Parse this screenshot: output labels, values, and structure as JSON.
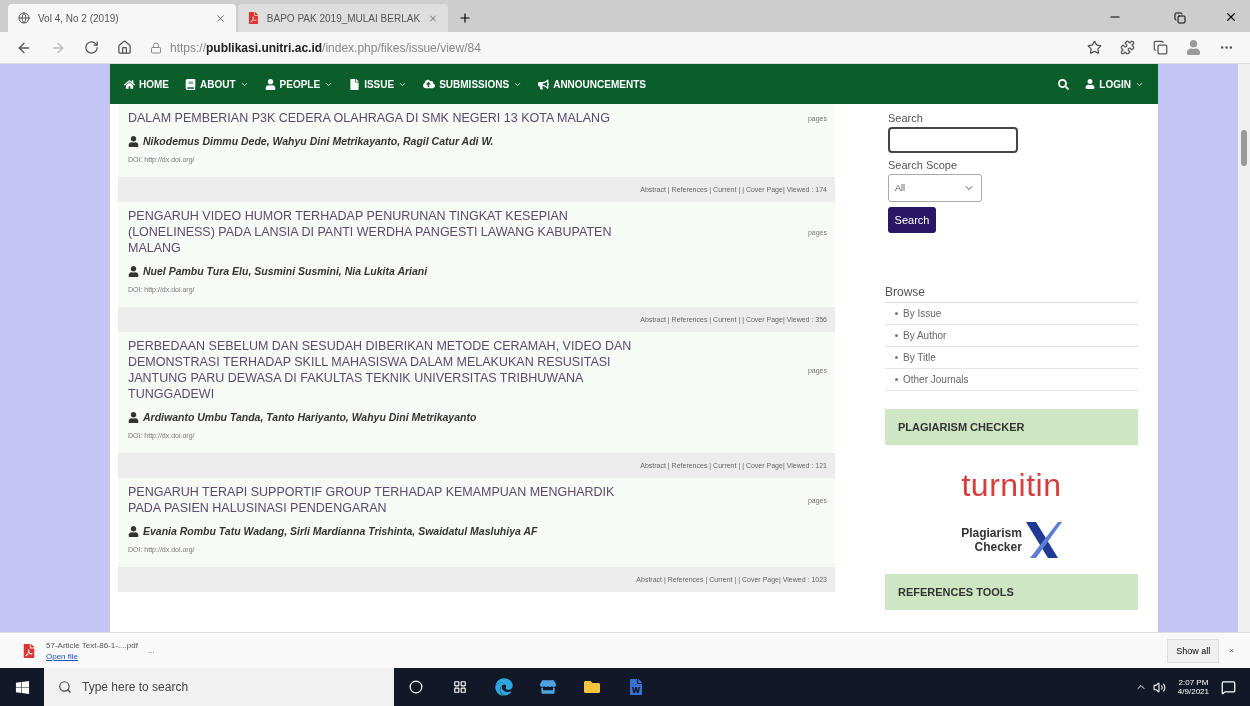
{
  "browser": {
    "tabs": [
      {
        "title": "Vol 4, No 2 (2019)",
        "kind": "page",
        "selected": true
      },
      {
        "title": "BAPO PAK 2019_MULAI BERLAK",
        "kind": "pdf",
        "selected": false
      }
    ],
    "url_scheme": "https://",
    "url_host": "publikasi.unitri.ac.id",
    "url_path": "/index.php/fikes/issue/view/84"
  },
  "nav": {
    "items": [
      {
        "label": "HOME",
        "dropdown": false
      },
      {
        "label": "ABOUT",
        "dropdown": true
      },
      {
        "label": "PEOPLE",
        "dropdown": true
      },
      {
        "label": "ISSUE",
        "dropdown": true
      },
      {
        "label": "SUBMISSIONS",
        "dropdown": true
      },
      {
        "label": "ANNOUNCEMENTS",
        "dropdown": false
      }
    ],
    "login": "LOGIN"
  },
  "articles": [
    {
      "title": "DALAM PEMBERIAN P3K CEDERA OLAHRAGA DI SMK NEGERI 13 KOTA MALANG",
      "authors": "Nikodemus Dimmu Dede, Wahyu Dini Metrikayanto, Ragil Catur Adi W.",
      "doi": "DOI: http://dx.doi.org/",
      "pages": "pages",
      "meta": "Abstract | References | Current | | Cover Page| Viewed : 174"
    },
    {
      "title": "PENGARUH VIDEO HUMOR TERHADAP PENURUNAN TINGKAT KESEPIAN (LONELINESS) PADA LANSIA DI PANTI WERDHA PANGESTI LAWANG KABUPATEN MALANG",
      "authors": "Nuel Pambu Tura Elu, Susmini Susmini, Nia Lukita Ariani",
      "doi": "DOI: http://dx.doi.org/",
      "pages": "pages",
      "meta": "Abstract | References | Current | | Cover Page| Viewed : 356"
    },
    {
      "title": "PERBEDAAN SEBELUM DAN SESUDAH DIBERIKAN METODE CERAMAH, VIDEO DAN DEMONSTRASI TERHADAP SKILL MAHASISWA DALAM MELAKUKAN RESUSITASI JANTUNG PARU DEWASA DI FAKULTAS TEKNIK UNIVERSITAS TRIBHUWANA TUNGGADEWI",
      "authors": "Ardiwanto Umbu Tanda, Tanto Hariyanto, Wahyu Dini Metrikayanto",
      "doi": "DOI: http://dx.doi.org/",
      "pages": "pages",
      "meta": "Abstract | References | Current | | Cover Page| Viewed : 121"
    },
    {
      "title": "PENGARUH TERAPI SUPPORTIF GROUP TERHADAP KEMAMPUAN MENGHARDIK PADA PASIEN HALUSINASI PENDENGARAN",
      "authors": "Evania Rombu Tatu Wadang, Sirli Mardianna Trishinta, Swaidatul Masluhiya AF",
      "doi": "DOI: http://dx.doi.org/",
      "pages": "pages",
      "meta": "Abstract | References | Current | | Cover Page| Viewed : 1023"
    }
  ],
  "sidebar": {
    "search_label": "Search",
    "scope_label": "Search Scope",
    "scope_value": "All",
    "search_button": "Search",
    "browse_title": "Browse",
    "browse_items": [
      "By Issue",
      "By Author",
      "By Title",
      "Other Journals"
    ],
    "plagiarism_title": "PLAGIARISM CHECKER",
    "turnitin": "turnitin",
    "pcx_line1": "Plagiarism",
    "pcx_line2": "Checker",
    "references_title": "REFERENCES TOOLS"
  },
  "download_bar": {
    "file": "57-Article Text-86-1-....pdf",
    "open": "Open file",
    "more": "...",
    "show_all": "Show all",
    "close": "×"
  },
  "taskbar": {
    "search_placeholder": "Type here to search",
    "time": "2:07 PM",
    "date": "4/9/2021"
  }
}
